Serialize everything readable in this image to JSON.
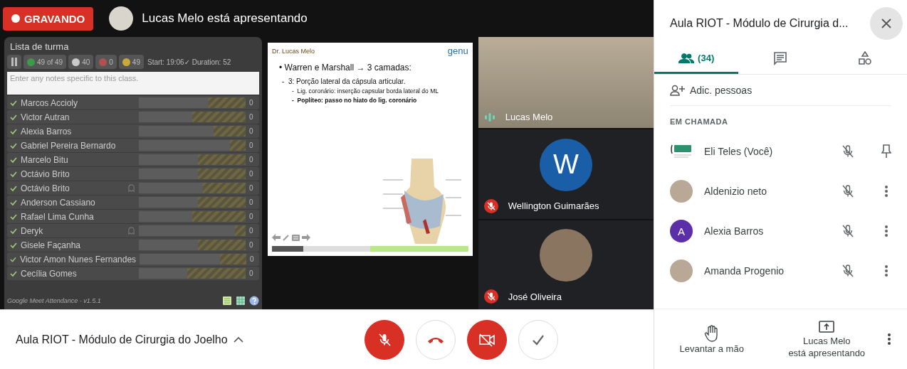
{
  "recording": {
    "label": "GRAVANDO"
  },
  "presenter_banner": {
    "text": "Lucas Melo está apresentando"
  },
  "attendance": {
    "title": "Lista de turma",
    "stats": [
      {
        "kind": "present",
        "text": "49 of 49"
      },
      {
        "kind": "ghost",
        "text": "40"
      },
      {
        "kind": "absent",
        "text": "0"
      },
      {
        "kind": "unknown",
        "text": "49"
      }
    ],
    "timing": "Start: 19:06✓ Duration: 52",
    "notes_placeholder": "Enter any notes specific to this class.",
    "students": [
      {
        "name": "Marcos Accioly",
        "checked": true,
        "ghost": false,
        "level": 0.35,
        "count": "0"
      },
      {
        "name": "Victor Autran",
        "checked": true,
        "ghost": false,
        "level": 0.5,
        "count": "0"
      },
      {
        "name": "Alexia Barros",
        "checked": true,
        "ghost": false,
        "level": 0.3,
        "count": "0"
      },
      {
        "name": "Gabriel Pereira Bernardo",
        "checked": true,
        "ghost": false,
        "level": 0.15,
        "count": "0"
      },
      {
        "name": "Marcelo Bitu",
        "checked": true,
        "ghost": false,
        "level": 0.45,
        "count": "0"
      },
      {
        "name": "Octávio Brito",
        "checked": true,
        "ghost": false,
        "level": 0.45,
        "count": "0"
      },
      {
        "name": "Octávio Brito",
        "checked": true,
        "ghost": true,
        "level": 0.4,
        "count": "0"
      },
      {
        "name": "Anderson Cassiano",
        "checked": true,
        "ghost": false,
        "level": 0.45,
        "count": "0"
      },
      {
        "name": "Rafael Lima Cunha",
        "checked": true,
        "ghost": false,
        "level": 0.5,
        "count": "0"
      },
      {
        "name": "Deryk",
        "checked": true,
        "ghost": true,
        "level": 0.1,
        "count": "0"
      },
      {
        "name": "Gisele Façanha",
        "checked": true,
        "ghost": false,
        "level": 0.45,
        "count": "0"
      },
      {
        "name": "Victor Amon Nunes Fernandes",
        "checked": true,
        "ghost": false,
        "level": 0.25,
        "count": "0"
      },
      {
        "name": "Cecília Gomes",
        "checked": true,
        "ghost": false,
        "level": 0.55,
        "count": "0"
      }
    ],
    "footer": "Google Meet Attendance - v1.5.1"
  },
  "slide": {
    "author_logo": "Dr. Lucas Melo",
    "brand_logo": "genu",
    "heading": "• Warren e Marshall → 3 camadas:",
    "subheading": "-  3: Porção lateral da cápsula articular.",
    "points": [
      {
        "text": "-  Lig. coronário: inserção capsular borda lateral do ML",
        "bold": false
      },
      {
        "text": "-  Poplíteo: passo no hiato do lig. coronário",
        "bold": true
      }
    ]
  },
  "tiles": [
    {
      "kind": "video",
      "name": "Lucas Melo",
      "muted": false
    },
    {
      "kind": "initial",
      "initial": "W",
      "name": "Wellington Guimarães",
      "muted": true
    },
    {
      "kind": "photo",
      "name": "José Oliveira",
      "muted": true
    }
  ],
  "bottom_bar": {
    "meeting_title": "Aula RIOT - Módulo de Cirurgia do Joelho",
    "controls": [
      {
        "kind": "mic",
        "off": true
      },
      {
        "kind": "hangup",
        "off": false
      },
      {
        "kind": "camera",
        "off": true
      },
      {
        "kind": "check",
        "off": false
      }
    ]
  },
  "side_panel": {
    "title": "Aula RIOT - Módulo de Cirurgia d...",
    "tabs": [
      {
        "kind": "people",
        "label": "(34)",
        "selected": true
      },
      {
        "kind": "chat",
        "selected": false
      },
      {
        "kind": "activities",
        "selected": false
      }
    ],
    "add_people": "Adic. pessoas",
    "section": "EM CHAMADA",
    "participants": [
      {
        "name": "Eli Teles (Você)",
        "avatar": {
          "kind": "logo"
        },
        "muted": true,
        "is_self": true
      },
      {
        "name": "Aldenizio neto",
        "avatar": {
          "kind": "photo"
        },
        "muted": true,
        "is_self": false
      },
      {
        "name": "Alexia Barros",
        "avatar": {
          "kind": "initial",
          "initial": "A"
        },
        "muted": true,
        "is_self": false
      },
      {
        "name": "Amanda Progenio",
        "avatar": {
          "kind": "photo"
        },
        "muted": true,
        "is_self": false
      }
    ],
    "actions": [
      {
        "kind": "hand",
        "lines": [
          "Levantar a mão"
        ]
      },
      {
        "kind": "present",
        "lines": [
          "Lucas Melo",
          "está apresentando"
        ]
      }
    ]
  }
}
